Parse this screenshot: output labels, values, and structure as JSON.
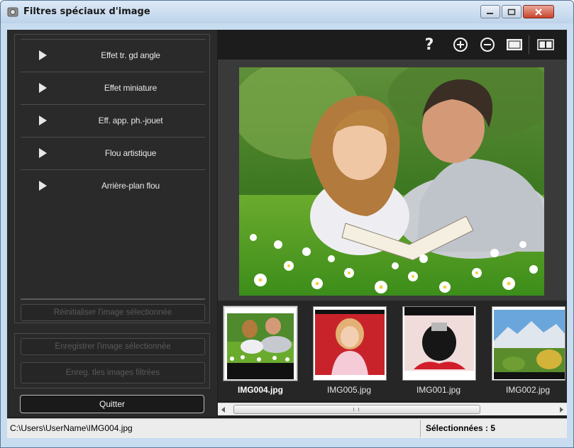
{
  "window": {
    "title": "Filtres spéciaux d'image"
  },
  "filters": [
    {
      "label": "Effet tr. gd angle"
    },
    {
      "label": "Effet miniature"
    },
    {
      "label": "Eff. app. ph.-jouet"
    },
    {
      "label": "Flou artistique"
    },
    {
      "label": "Arrière-plan flou"
    }
  ],
  "buttons": {
    "reset_label": "Réinitialiser l'image sélectionnée",
    "save_selected_label": "Enregistrer l'image sélectionnée",
    "save_filtered_label": "Enreg. tles images filtrées",
    "quit_label": "Quitter"
  },
  "toolbar": {
    "help_label": "?"
  },
  "thumbnails": [
    {
      "name": "IMG004.jpg",
      "selected": true
    },
    {
      "name": "IMG005.jpg",
      "selected": false
    },
    {
      "name": "IMG001.jpg",
      "selected": false
    },
    {
      "name": "IMG002.jpg",
      "selected": false
    }
  ],
  "status": {
    "path": "C:\\Users\\UserName\\IMG004.jpg",
    "selection": "Sélectionnées : 5"
  },
  "colors": {
    "panel_bg": "#2a2a2a",
    "accent_close": "#c8432b"
  }
}
